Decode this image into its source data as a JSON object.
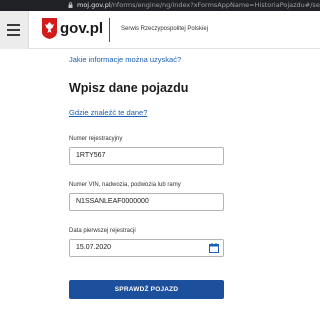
{
  "browser": {
    "url_host": "moj.gov.pl",
    "url_path": "/nforms/engine/ng/index?xFormsAppName=HistoriaPojazdu#/search"
  },
  "header": {
    "brand": "gov.pl",
    "service": "Serwis Rzeczypospolitej Polskiej"
  },
  "page": {
    "info_link": "Jakie informacje można uzyskać?",
    "heading": "Wpisz dane pojazdu",
    "where_link": "Gdzie znaleźć te dane?"
  },
  "form": {
    "registration": {
      "label": "Numer rejestracyjny",
      "value": "1RTY567"
    },
    "vin": {
      "label": "Numer VIN, nadwozia, podwozia lub ramy",
      "value": "N1SSANLEAF0000000"
    },
    "first_registration": {
      "label": "Data pierwszej rejestracji",
      "value": "15.07.2020"
    },
    "submit_label": "SPRAWDŹ POJAZD"
  },
  "colors": {
    "accent": "#1c4f9c",
    "link": "#1a5fb4",
    "brand_red": "#d21b1b"
  },
  "icons": {
    "menu": "hamburger-icon",
    "emblem": "polish-eagle-icon",
    "calendar": "calendar-icon",
    "lock": "lock-icon"
  }
}
